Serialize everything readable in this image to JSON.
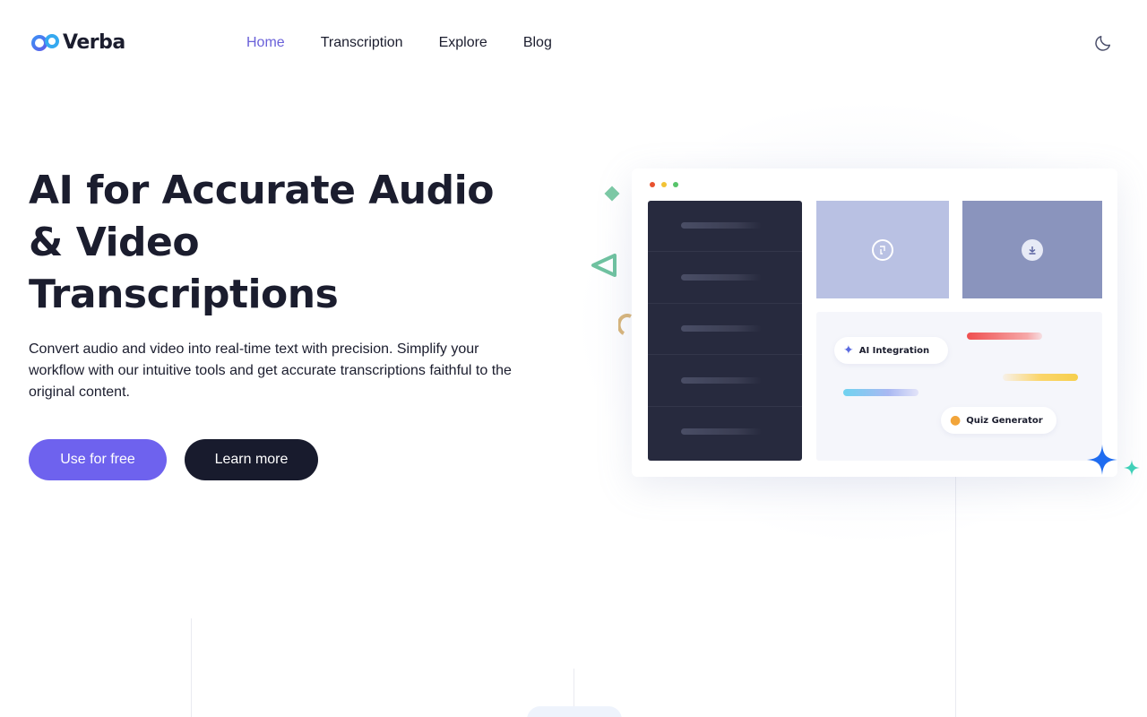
{
  "brand": {
    "name": "Verba",
    "logo_icon": "infinity-logo-icon"
  },
  "nav": {
    "items": [
      {
        "label": "Home",
        "active": true
      },
      {
        "label": "Transcription",
        "active": false
      },
      {
        "label": "Explore",
        "active": false
      },
      {
        "label": "Blog",
        "active": false
      }
    ],
    "theme_toggle_icon": "moon-icon"
  },
  "hero": {
    "title_line1": "AI for Accurate Audio",
    "title_line2": "& Video",
    "title_line3": "Transcriptions",
    "description": "Convert audio and video into real-time text with precision. Simplify your workflow with our intuitive tools and get accurate transcriptions faithful to the original content.",
    "primary_button": "Use for free",
    "secondary_button": "Learn more"
  },
  "illustration": {
    "chip_ai": "AI Integration",
    "chip_quiz": "Quiz Generator",
    "tile1_icon": "refresh-icon",
    "tile2_icon": "download-icon",
    "window_dot_colors": [
      "#e8522e",
      "#f2c335",
      "#57c46a"
    ]
  },
  "colors": {
    "accent": "#6e62ee",
    "dark": "#181b2d",
    "nav_active": "#6a61d9"
  }
}
